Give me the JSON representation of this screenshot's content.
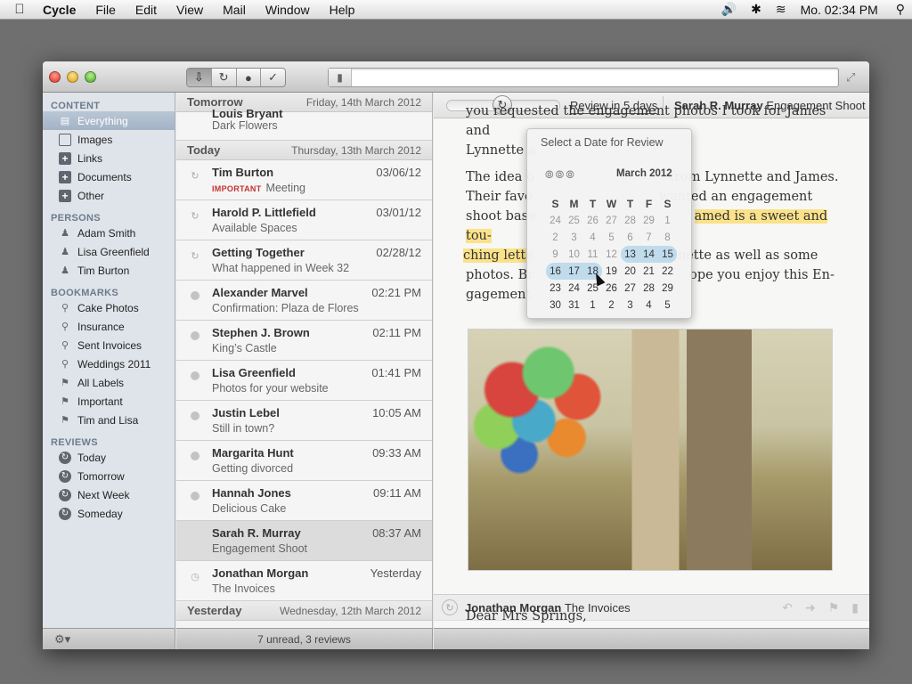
{
  "menubar": {
    "app_name": "Cycle",
    "items": [
      "File",
      "Edit",
      "View",
      "Mail",
      "Window",
      "Help"
    ],
    "clock": "Mo. 02:34 PM"
  },
  "toolbar": {
    "segments": [
      "archive-icon",
      "refresh-icon",
      "circle-icon",
      "check-icon"
    ]
  },
  "sidebar": {
    "sections": [
      {
        "title": "CONTENT",
        "items": [
          "Everything",
          "Images",
          "Links",
          "Documents",
          "Other"
        ]
      },
      {
        "title": "PERSONS",
        "items": [
          "Adam Smith",
          "Lisa Greenfield",
          "Tim Burton"
        ]
      },
      {
        "title": "BOOKMARKS",
        "items": [
          "Cake Photos",
          "Insurance",
          "Sent Invoices",
          "Weddings 2011",
          "All Labels",
          "Important",
          "Tim and Lisa"
        ]
      },
      {
        "title": "REVIEWS",
        "items": [
          "Today",
          "Tomorrow",
          "Next Week",
          "Someday"
        ]
      }
    ]
  },
  "messagelist": {
    "group_tomorrow": {
      "label": "Tomorrow",
      "date": "Friday, 14th March 2012"
    },
    "cut_row": {
      "from": "Louis Bryant",
      "subject": "Dark Flowers"
    },
    "group_today": {
      "label": "Today",
      "date": "Thursday, 13th March 2012"
    },
    "messages": [
      {
        "from": "Tim Burton",
        "tag": "IMPORTANT",
        "subject": "Meeting",
        "date": "03/06/12"
      },
      {
        "from": "Harold P. Littlefield",
        "subject": "Available Spaces",
        "date": "03/01/12"
      },
      {
        "from": "Getting Together",
        "subject": "What happened in Week 32",
        "date": "02/28/12"
      },
      {
        "from": "Alexander Marvel",
        "subject": "Confirmation: Plaza de Flores",
        "date": "02:21 PM"
      },
      {
        "from": "Stephen J. Brown",
        "subject": "King’s Castle",
        "date": "02:11 PM"
      },
      {
        "from": "Lisa Greenfield",
        "subject": "Photos for your website",
        "date": "01:41 PM"
      },
      {
        "from": "Justin Lebel",
        "subject": "Still in town?",
        "date": "10:05 AM"
      },
      {
        "from": "Margarita Hunt",
        "subject": "Getting divorced",
        "date": "09:33 AM"
      },
      {
        "from": "Hannah Jones",
        "subject": "Delicious Cake",
        "date": "09:11 AM"
      },
      {
        "from": "Sarah R. Murray",
        "subject": "Engagement Shoot",
        "date": "08:37 AM"
      },
      {
        "from": "Jonathan Morgan",
        "subject": "The Invoices",
        "date": "Yesterday"
      }
    ],
    "group_yesterday": {
      "label": "Yesterday",
      "date": "Wednesday, 12th March 2012"
    },
    "status": "7 unread, 3 reviews"
  },
  "reader": {
    "review_label": "Review in 5 days",
    "sender": "Sarah R. Murray",
    "subject": "Engagement Shoot",
    "para1_line1": "you requested the engagement photos I took for James and",
    "para1_line2": "Lynnette a",
    "p2_l1a": "The idea o",
    "p2_l1b": "from Lynnette and James.",
    "p2_l2a": "Their favo",
    "p2_l2b": "wanted an engagement",
    "p2_l3a": "shoot base",
    "p2_l3hl": "amed is a sweet and tou-",
    "p2_l4hl": "ching lette",
    "p2_l4b": "nette as well as some",
    "p2_l5a": "photos. Br",
    "p2_l5b": "ope you enjoy this En-",
    "p2_l6a": "gagement",
    "message2_sender": "Jonathan Morgan",
    "message2_subject": "The Invoices",
    "message2_greeting": "Dear Mrs Springs,"
  },
  "datepicker": {
    "title": "Select a Date for Review",
    "month": "March 2012",
    "weekdays": [
      "S",
      "M",
      "T",
      "W",
      "T",
      "F",
      "S"
    ],
    "weeks": [
      [
        "24",
        "25",
        "26",
        "27",
        "28",
        "29",
        "1"
      ],
      [
        "2",
        "3",
        "4",
        "5",
        "6",
        "7",
        "8"
      ],
      [
        "9",
        "10",
        "11",
        "12",
        "13",
        "14",
        "15"
      ],
      [
        "16",
        "17",
        "18",
        "19",
        "20",
        "21",
        "22"
      ],
      [
        "23",
        "24",
        "25",
        "26",
        "27",
        "28",
        "29"
      ],
      [
        "30",
        "31",
        "1",
        "2",
        "3",
        "4",
        "5"
      ]
    ]
  },
  "colors": {
    "selection_blue": "#bfdbec",
    "highlight_yellow": "#fbe28a",
    "important_red": "#c53232"
  }
}
